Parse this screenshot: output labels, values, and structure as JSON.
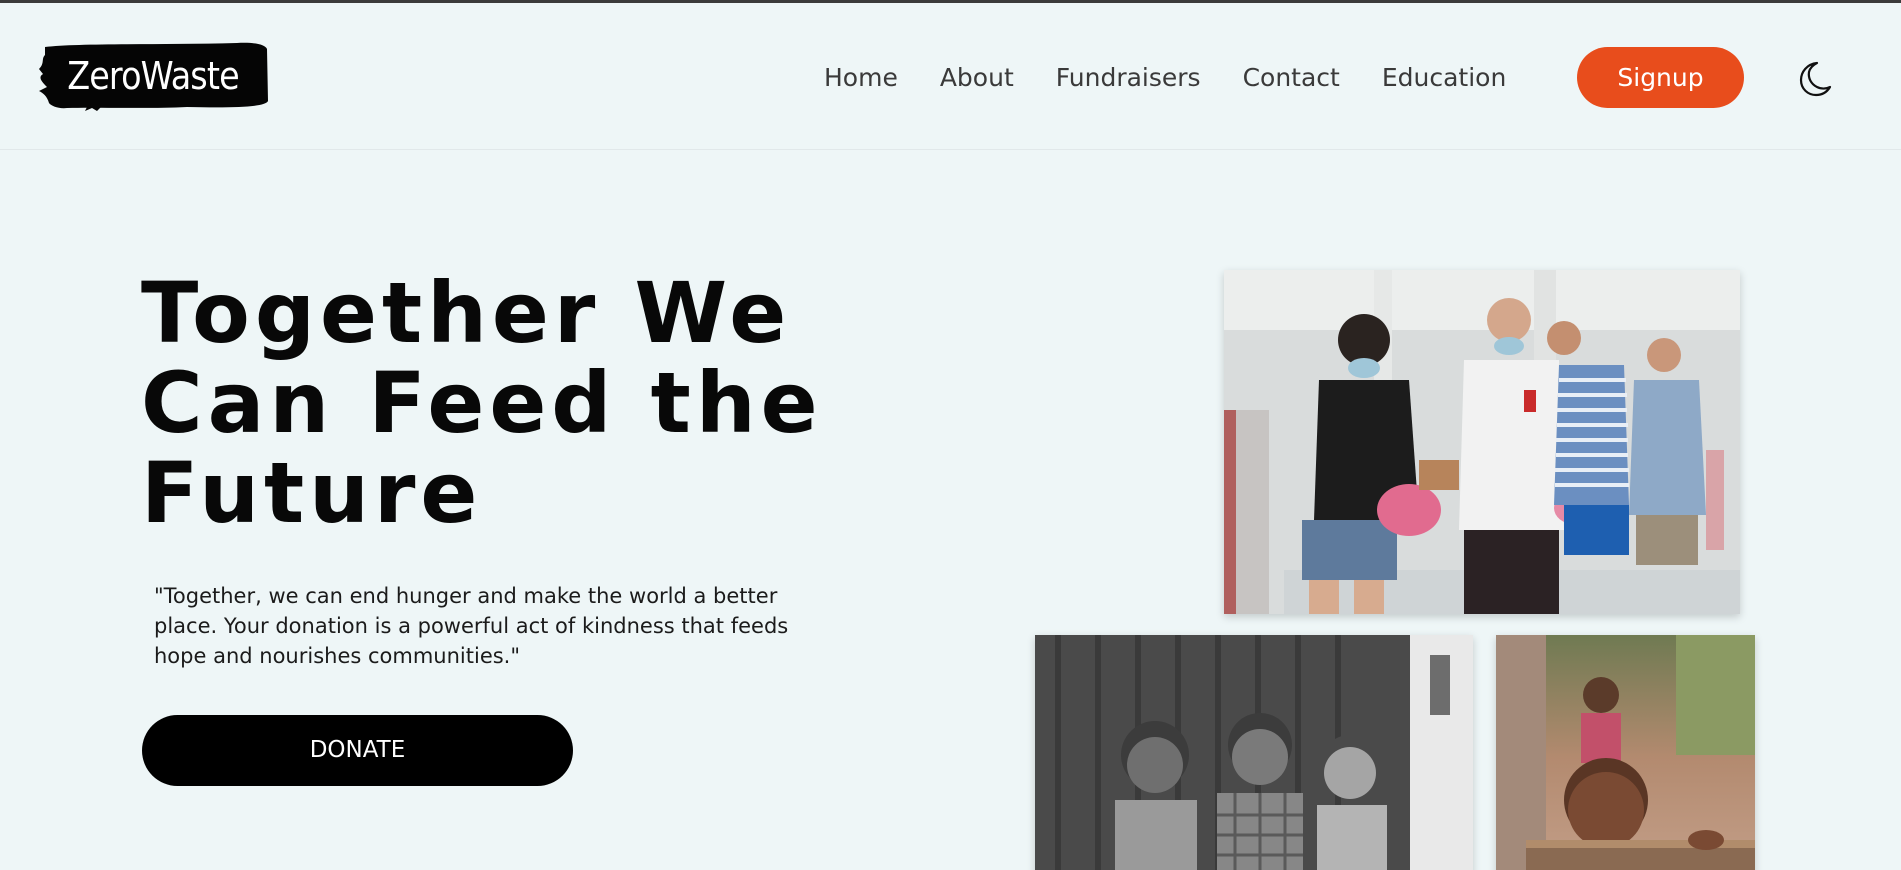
{
  "header": {
    "logo_text": "ZeroWaste",
    "nav": [
      {
        "label": "Home"
      },
      {
        "label": "About"
      },
      {
        "label": "Fundraisers"
      },
      {
        "label": "Contact"
      },
      {
        "label": "Education"
      }
    ],
    "signup_label": "Signup",
    "theme_icon": "moon-icon"
  },
  "hero": {
    "title_lines": [
      "Together We",
      "Can Feed the",
      "Future"
    ],
    "quote": "\"Together, we can end hunger and make the world a better place. Your donation is a powerful act of kindness that feeds hope and nourishes communities.\"",
    "donate_label": "DONATE"
  },
  "colors": {
    "background": "#eef6f7",
    "accent": "#e84d1c",
    "text": "#080808"
  }
}
